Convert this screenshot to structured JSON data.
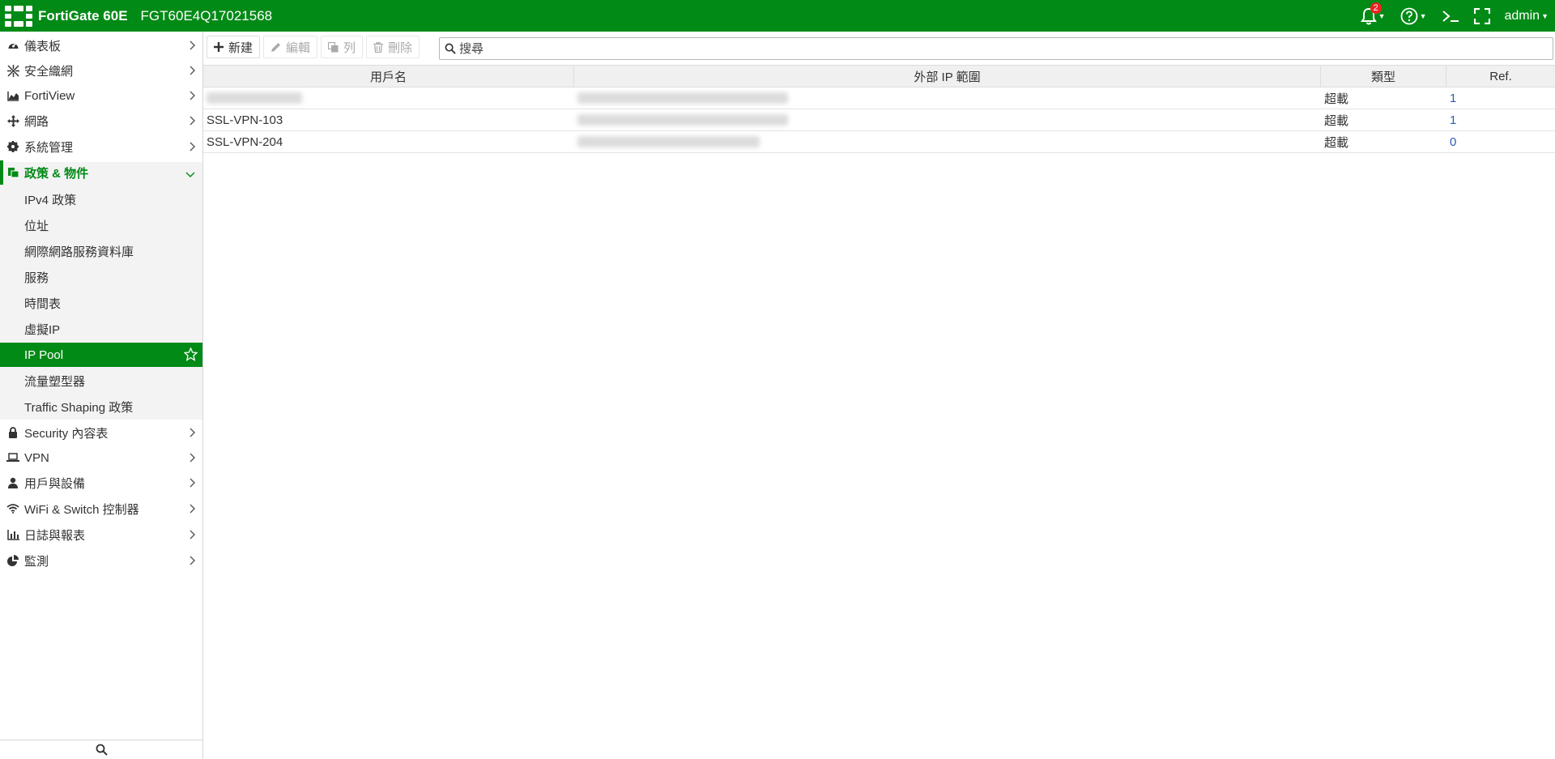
{
  "header": {
    "brand": "FortiGate 60E",
    "serial": "FGT60E4Q17021568",
    "notification_count": "2",
    "user": "admin"
  },
  "sidebar": {
    "items": [
      {
        "label": "儀表板",
        "icon": "dashboard-icon"
      },
      {
        "label": "安全織網",
        "icon": "security-fabric-icon"
      },
      {
        "label": "FortiView",
        "icon": "chart-icon"
      },
      {
        "label": "網路",
        "icon": "network-icon"
      },
      {
        "label": "系統管理",
        "icon": "gear-icon"
      },
      {
        "label": "政策 & 物件",
        "icon": "policy-icon"
      },
      {
        "label": "Security 內容表",
        "icon": "lock-icon"
      },
      {
        "label": "VPN",
        "icon": "laptop-icon"
      },
      {
        "label": "用戶與設備",
        "icon": "user-icon"
      },
      {
        "label": "WiFi & Switch 控制器",
        "icon": "wifi-icon"
      },
      {
        "label": "日誌與報表",
        "icon": "bar-chart-icon"
      },
      {
        "label": "監測",
        "icon": "pie-chart-icon"
      }
    ],
    "sub_items": [
      {
        "label": "IPv4 政策"
      },
      {
        "label": "位址"
      },
      {
        "label": "網際網路服務資料庫"
      },
      {
        "label": "服務"
      },
      {
        "label": "時間表"
      },
      {
        "label": "虛擬IP"
      },
      {
        "label": "IP Pool"
      },
      {
        "label": "流量塑型器"
      },
      {
        "label": "Traffic Shaping 政策"
      }
    ]
  },
  "toolbar": {
    "new_label": "新建",
    "edit_label": "編輯",
    "clone_label": "列",
    "delete_label": "刪除",
    "search_placeholder": "搜尋"
  },
  "table": {
    "columns": [
      "用戶名",
      "外部 IP 範圍",
      "類型",
      "Ref."
    ],
    "rows": [
      {
        "name": "",
        "name_redacted": true,
        "type": "超載",
        "ref": "1"
      },
      {
        "name": "SSL-VPN-103",
        "name_redacted": false,
        "type": "超載",
        "ref": "1"
      },
      {
        "name": "SSL-VPN-204",
        "name_redacted": false,
        "type": "超載",
        "ref": "0"
      }
    ]
  },
  "colors": {
    "brand_green": "#028a16",
    "link_blue": "#2a5cb0",
    "badge_red": "#ee2222"
  }
}
